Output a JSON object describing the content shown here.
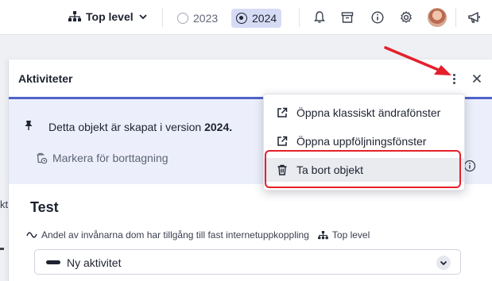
{
  "topbar": {
    "level_label": "Top level",
    "years": [
      {
        "label": "2023",
        "selected": false
      },
      {
        "label": "2024",
        "selected": true
      }
    ],
    "icons": [
      "hierarchy-icon",
      "bell-icon",
      "archive-icon",
      "info-icon",
      "gear-icon",
      "avatar",
      "megaphone-icon"
    ]
  },
  "panel": {
    "title": "Aktiviteter",
    "info_text_prefix": "Detta objekt är skapat i version",
    "info_version": "2024.",
    "mark_delete_label": "Markera för borttagning",
    "item_title": "Test",
    "meta_text": "Andel av invånarna dom har tillgång till fast internetuppkoppling",
    "meta_level": "Top level",
    "status_value": "Ny aktivitet"
  },
  "menu": {
    "items": [
      {
        "label": "Öppna klassiskt ändrafönster",
        "icon": "external-link-icon"
      },
      {
        "label": "Öppna uppföljningsfönster",
        "icon": "external-link-icon"
      },
      {
        "label": "Ta bort objekt",
        "icon": "trash-icon"
      }
    ]
  },
  "background": {
    "partial_text": "kt"
  },
  "colors": {
    "accent": "#4f63c9",
    "highlight": "#e4202b",
    "info_bg": "#eceffb"
  }
}
